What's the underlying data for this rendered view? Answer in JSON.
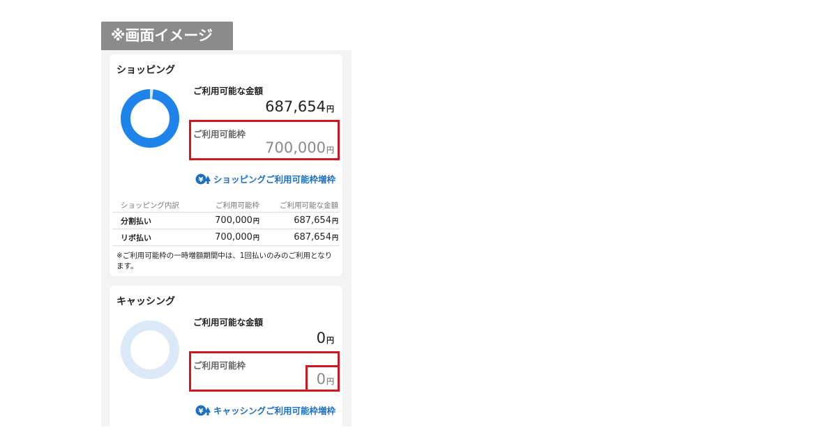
{
  "header": {
    "label": "※画面イメージ"
  },
  "shopping": {
    "title": "ショッピング",
    "available_label": "ご利用可能な金額",
    "available_amount": "687,654",
    "limit_label": "ご利用可能枠",
    "limit_amount": "700,000",
    "yen": "円",
    "increase_link": "ショッピングご利用可能枠増枠",
    "usage_ratio": 0.982,
    "table": {
      "headers": [
        "ショッピング内訳",
        "ご利用可能枠",
        "ご利用可能な金額"
      ],
      "rows": [
        {
          "name": "分割払い",
          "limit": "700,000",
          "available": "687,654"
        },
        {
          "name": "リボ払い",
          "limit": "700,000",
          "available": "687,654"
        }
      ]
    },
    "note": "※ご利用可能枠の一時増額期間中は、1回払いのみのご利用となります。"
  },
  "cashing": {
    "title": "キャッシング",
    "available_label": "ご利用可能な金額",
    "available_amount": "0",
    "limit_label": "ご利用可能枠",
    "limit_amount": "0",
    "yen": "円",
    "increase_link": "キャッシングご利用可能枠増枠",
    "usage_ratio": 0
  },
  "colors": {
    "accent_blue": "#1e84ea",
    "light_blue": "#dbe8f8",
    "highlight_red": "#d0161e",
    "link_blue": "#1e6fc2"
  }
}
